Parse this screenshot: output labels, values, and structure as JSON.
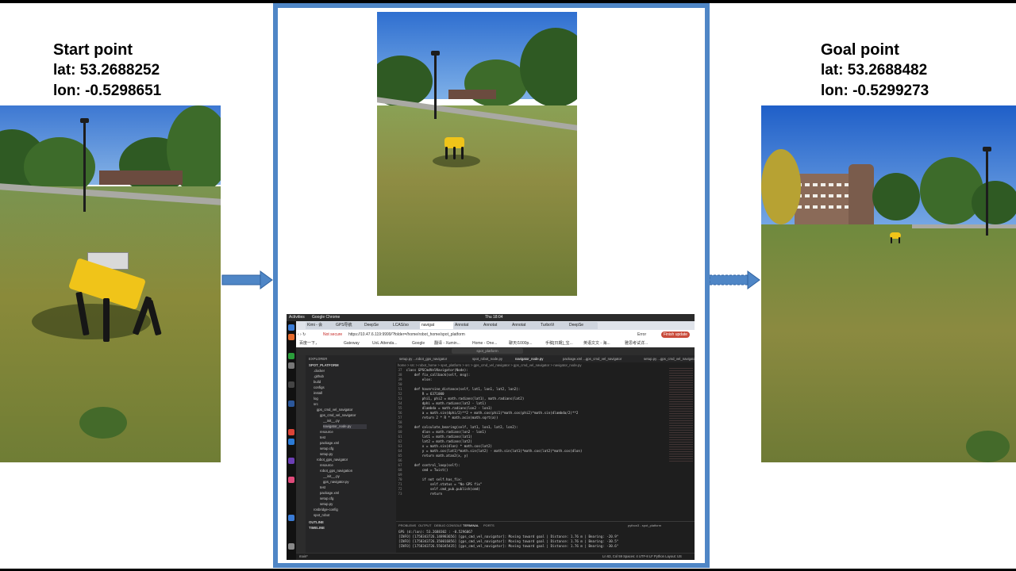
{
  "start": {
    "title": "Start point",
    "lat": "lat: 53.2688252",
    "lon": "lon: -0.5298651"
  },
  "goal": {
    "title": "Goal point",
    "lat": "lat: 53.2688482",
    "lon": "lon: -0.5299273"
  },
  "colors": {
    "frame": "#4f86c6",
    "arrow": "#4f86c6",
    "robot": "#f0c419"
  },
  "screenshot": {
    "topbar": {
      "activities": "Activities",
      "app": "Google Chrome",
      "clock": "Thu 18:04"
    },
    "tabs": [
      "Kimi - 会",
      "GPS导航",
      "DeepSe",
      "LCAS/so",
      "navigat",
      "Annotat",
      "Annotat",
      "Annotat",
      "TurboVi",
      "DeepSe"
    ],
    "active_tab": "navigat",
    "url": {
      "security": "Not secure",
      "address": "https://10.47.6.119:9999/?folder=/home/robot_home/spot_platform",
      "button": "Finish update",
      "profile": "Error"
    },
    "bookmarks": [
      "百度一下，",
      "Gateway",
      "UoL Attenda...",
      "Google",
      "翻译 - Xumin...",
      "Home - One...",
      "聊天/1000p...",
      "手稿[日期]_宝...",
      "英语文文 - 海...",
      "雅思考试详..."
    ],
    "command": "spot_platform",
    "explorer": {
      "title": "EXPLORER",
      "root": "SPOT_PLATFORM",
      "items": [
        ".docker",
        ".github",
        "build",
        "configs",
        "install",
        "log",
        "src",
        "gps_cmd_vel_navigator",
        "gps_cmd_vel_navigator",
        "__init__.py",
        "navigator_node.py",
        "resource",
        "test",
        "package.xml",
        "setup.cfg",
        "setup.py",
        "robot_gps_navigator",
        "resource",
        "robot_gps_navigation",
        "__init__.py",
        "gps_navigator.py",
        "test",
        "package.xml",
        "setup.cfg",
        "setup.py",
        "rosbridge-config",
        "spot_robot"
      ],
      "outline": "OUTLINE",
      "timeline": "TIMELINE"
    },
    "editor_tabs": [
      "setup.py ...robot_gps_navigator",
      "spot_robot_node.py",
      "navigator_node.py",
      "package.xml ...gps_cmd_vel_navigator",
      "setup.py ...gps_cmd_vel_navigator"
    ],
    "breadcrumb": "home > src > robot_home > spot_platform > src > gps_cmd_vel_navigator > gps_cmd_vel_navigator > navigator_node.py",
    "code": [
      [
        "37",
        "class GPSCmdVelNavigator(Node):"
      ],
      [
        "38",
        "    def fix_callback(self, msg):"
      ],
      [
        "39",
        "        else:"
      ],
      [
        "50",
        ""
      ],
      [
        "51",
        "    def haversine_distance(self, lat1, lon1, lat2, lon2):"
      ],
      [
        "52",
        "        R = 6371000"
      ],
      [
        "53",
        "        phi1, phi2 = math.radians(lat1), math.radians(lat2)"
      ],
      [
        "54",
        "        dphi = math.radians(lat2 - lat1)"
      ],
      [
        "55",
        "        dlambda = math.radians(lon2 - lon1)"
      ],
      [
        "56",
        "        a = math.sin(dphi/2)**2 + math.cos(phi1)*math.cos(phi2)*math.sin(dlambda/2)**2"
      ],
      [
        "57",
        "        return 2 * R * math.asin(math.sqrt(a))"
      ],
      [
        "58",
        ""
      ],
      [
        "59",
        "    def calculate_bearing(self, lat1, lon1, lat2, lon2):"
      ],
      [
        "60",
        "        dlon = math.radians(lon2 - lon1)"
      ],
      [
        "61",
        "        lat1 = math.radians(lat1)"
      ],
      [
        "62",
        "        lat2 = math.radians(lat2)"
      ],
      [
        "63",
        "        x = math.sin(dlon) * math.cos(lat2)"
      ],
      [
        "64",
        "        y = math.cos(lat1)*math.sin(lat2) - math.sin(lat1)*math.cos(lat2)*math.cos(dlon)"
      ],
      [
        "65",
        "        return math.atan2(x, y)"
      ],
      [
        "66",
        ""
      ],
      [
        "67",
        "    def control_loop(self):"
      ],
      [
        "68",
        "        cmd = Twist()"
      ],
      [
        "69",
        ""
      ],
      [
        "70",
        "        if not self.has_fix:"
      ],
      [
        "71",
        "            self.status = \"No GPS fix\""
      ],
      [
        "72",
        "            self.cmd_pub.publish(cmd)"
      ],
      [
        "73",
        "            return"
      ]
    ],
    "panel_tabs": [
      "PROBLEMS",
      "OUTPUT",
      "DEBUG CONSOLE",
      "TERMINAL",
      "PORTS"
    ],
    "terminal_name": "python3 - spot_platform",
    "log": [
      "GPS (d:/lon): 53.2688302 : -0.5296067",
      "[INFO] [1758343726.148983656] [gps_cmd_vel_navigator]: Moving toward goal | Distance: 1.76 m | Bearing: -20.9°",
      "[INFO] [1758343726.350016856] [gps_cmd_vel_navigator]: Moving toward goal | Distance: 1.76 m | Bearing: -30.5°",
      "[INFO] [1758343726.550345435] [gps_cmd_vel_navigator]: Moving toward goal | Distance: 1.76 m | Bearing: -30.6°"
    ],
    "status": {
      "left": "main*",
      "right": "Ln 63, Col 59   Spaces: 4   UTF-8   LF   Python   Layout: US"
    }
  }
}
